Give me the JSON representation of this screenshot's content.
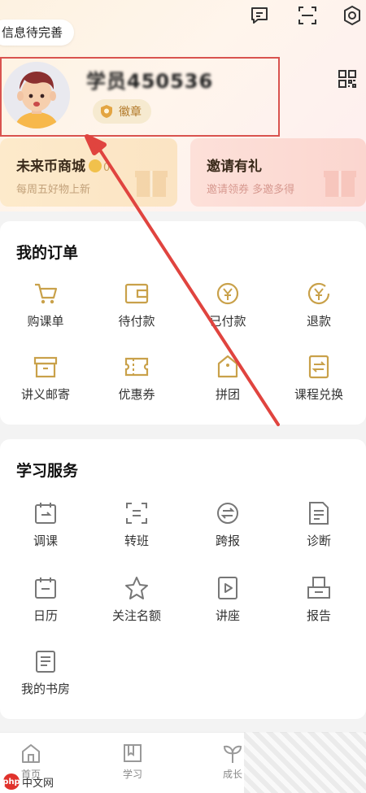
{
  "header": {
    "info_prompt": "信息待完善",
    "icons": [
      "message-icon",
      "scan-icon",
      "settings-icon"
    ]
  },
  "profile": {
    "username": "学员450536",
    "badge_label": "徽章",
    "qr_icon": "qr-code-icon"
  },
  "cards": {
    "mall": {
      "title": "未来币商城",
      "coin_count": "0",
      "subtitle": "每周五好物上新"
    },
    "invite": {
      "title": "邀请有礼",
      "subtitle": "邀请领券 多邀多得"
    }
  },
  "orders": {
    "title": "我的订单",
    "items": [
      {
        "label": "购课单",
        "icon": "cart-icon"
      },
      {
        "label": "待付款",
        "icon": "wallet-icon"
      },
      {
        "label": "已付款",
        "icon": "yuan-check-icon"
      },
      {
        "label": "退款",
        "icon": "yuan-refund-icon"
      },
      {
        "label": "讲义邮寄",
        "icon": "package-icon"
      },
      {
        "label": "优惠券",
        "icon": "coupon-icon"
      },
      {
        "label": "拼团",
        "icon": "group-tag-icon"
      },
      {
        "label": "课程兑换",
        "icon": "exchange-icon"
      }
    ]
  },
  "services": {
    "title": "学习服务",
    "items": [
      {
        "label": "调课",
        "icon": "calendar-adjust-icon"
      },
      {
        "label": "转班",
        "icon": "transfer-icon"
      },
      {
        "label": "跨报",
        "icon": "cross-register-icon"
      },
      {
        "label": "诊断",
        "icon": "diagnosis-icon"
      },
      {
        "label": "日历",
        "icon": "calendar-icon"
      },
      {
        "label": "关注名额",
        "icon": "star-icon"
      },
      {
        "label": "讲座",
        "icon": "play-icon"
      },
      {
        "label": "报告",
        "icon": "report-icon"
      },
      {
        "label": "我的书房",
        "icon": "bookshelf-icon"
      }
    ]
  },
  "bottom_nav": {
    "items": [
      {
        "label": "首页",
        "icon": "home-icon"
      },
      {
        "label": "学习",
        "icon": "book-icon"
      },
      {
        "label": "成长",
        "icon": "sprout-icon"
      }
    ]
  },
  "watermark": {
    "text": "中文网",
    "logo": "php"
  },
  "colors": {
    "accent": "#c9a14a",
    "annotation": "#d9534f"
  }
}
